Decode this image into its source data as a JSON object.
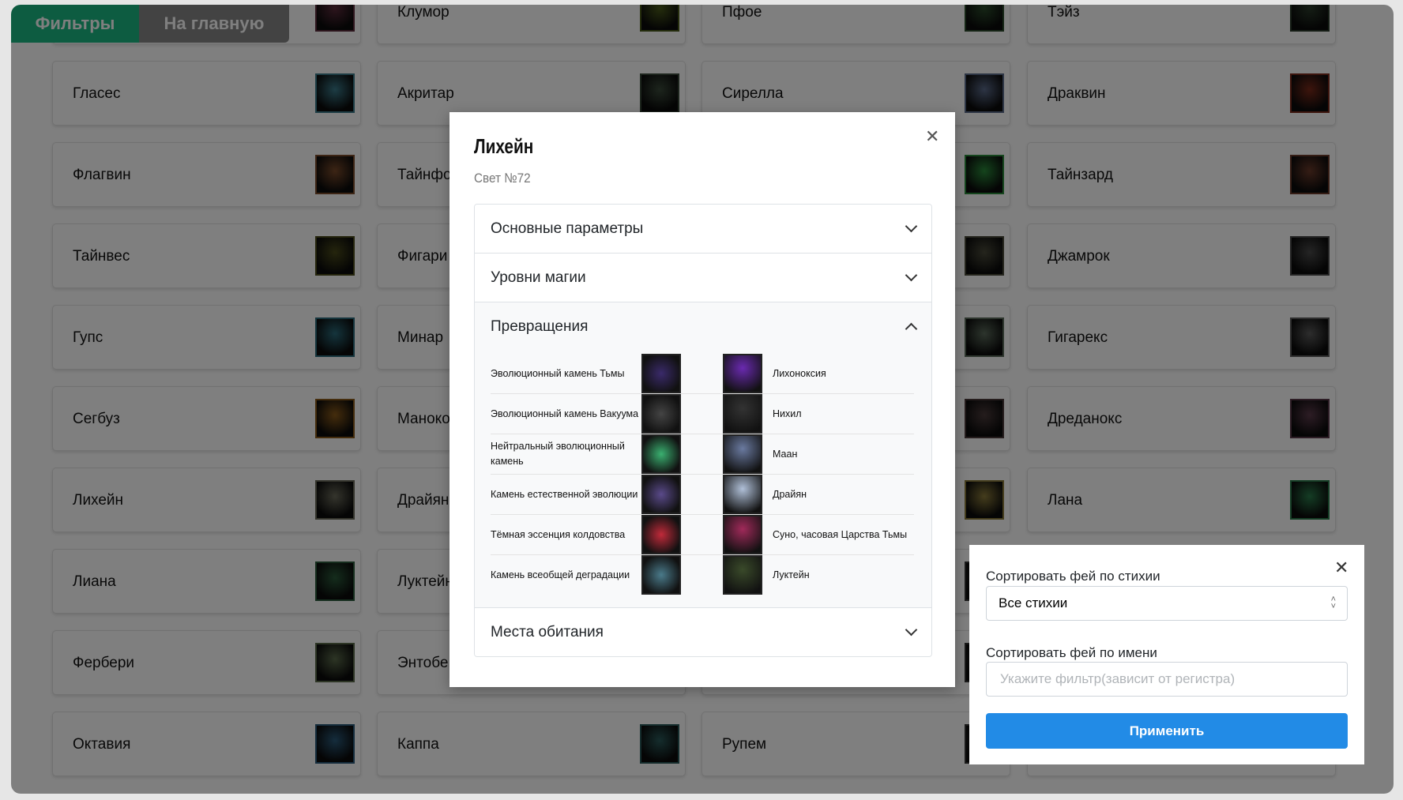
{
  "nav": {
    "filters_label": "Фильтры",
    "home_label": "На главную"
  },
  "cards": [
    {
      "name": "",
      "color": "#5a2a3a"
    },
    {
      "name": "Клумор",
      "color": "#4a5a1a"
    },
    {
      "name": "Пфое",
      "color": "#2a4a2a"
    },
    {
      "name": "Тэйз",
      "color": "#2a3a2a"
    },
    {
      "name": "Гласес",
      "color": "#3a7a8a"
    },
    {
      "name": "Акритар",
      "color": "#3a4a3a"
    },
    {
      "name": "Сирелла",
      "color": "#5a6a8a"
    },
    {
      "name": "Драквин",
      "color": "#7a2a1a"
    },
    {
      "name": "Флагвин",
      "color": "#7a4a2a"
    },
    {
      "name": "Тайнфо",
      "color": "#333"
    },
    {
      "name": "",
      "color": "#2a8a3a"
    },
    {
      "name": "Тайнзард",
      "color": "#6a3a2a"
    },
    {
      "name": "Тайнвес",
      "color": "#4a4a1a"
    },
    {
      "name": "Фигари",
      "color": "#333"
    },
    {
      "name": "",
      "color": "#4a4a3a"
    },
    {
      "name": "Джамрок",
      "color": "#4a4a4a"
    },
    {
      "name": "Гупс",
      "color": "#2a6a7a"
    },
    {
      "name": "Минар",
      "color": "#333"
    },
    {
      "name": "",
      "color": "#5a6a5a"
    },
    {
      "name": "Гигарекс",
      "color": "#5a5a5a"
    },
    {
      "name": "Сегбуз",
      "color": "#8a5a1a"
    },
    {
      "name": "Маноко",
      "color": "#333"
    },
    {
      "name": "",
      "color": "#4a3a3a"
    },
    {
      "name": "Дреданокс",
      "color": "#5a3a4a"
    },
    {
      "name": "Лихейн",
      "color": "#6a6a5a"
    },
    {
      "name": "Драйян",
      "color": "#333"
    },
    {
      "name": "",
      "color": "#8a7a3a"
    },
    {
      "name": "Лана",
      "color": "#2a7a4a"
    },
    {
      "name": "Лиана",
      "color": "#2a5a3a"
    },
    {
      "name": "Луктейн",
      "color": "#333"
    },
    {
      "name": "",
      "color": "#333"
    },
    {
      "name": "",
      "color": "#333"
    },
    {
      "name": "Фербери",
      "color": "#5a6a4a"
    },
    {
      "name": "Энтобе",
      "color": "#333"
    },
    {
      "name": "",
      "color": "#333"
    },
    {
      "name": "",
      "color": "#333"
    },
    {
      "name": "Октавия",
      "color": "#2a5a7a"
    },
    {
      "name": "Каппа",
      "color": "#2a5a5a"
    },
    {
      "name": "Рупем",
      "color": "#333"
    },
    {
      "name": "",
      "color": "#333"
    }
  ],
  "modal": {
    "title": "Лихейн",
    "subtitle": "Свет №72",
    "sections": {
      "main": "Основные параметры",
      "magic": "Уровни магии",
      "transform": "Превращения",
      "habitat": "Места обитания"
    },
    "transformations": [
      {
        "item": "Эволюционный камень Тьмы",
        "item_color": "#3a2a6a",
        "result": "Лихоноксия",
        "result_color": "#6a2ab0"
      },
      {
        "item": "Эволюционный камень Вакуума",
        "item_color": "#444",
        "result": "Нихил",
        "result_color": "#333"
      },
      {
        "item": "Нейтральный эволюционный камень",
        "item_color": "#3ab070",
        "result": "Маан",
        "result_color": "#6a7aa0"
      },
      {
        "item": "Камень естественной эволюции",
        "item_color": "#5a4a8a",
        "result": "Драйян",
        "result_color": "#b0c0d8"
      },
      {
        "item": "Тёмная эссенция колдовства",
        "item_color": "#c02a3a",
        "result": "Суно, часовая Царства Тьмы",
        "result_color": "#a02a5a"
      },
      {
        "item": "Камень всеобщей деградации",
        "item_color": "#4a7a8a",
        "result": "Луктейн",
        "result_color": "#3a4a2a"
      }
    ]
  },
  "filter": {
    "element_label": "Сортировать фей по стихии",
    "element_value": "Все стихии",
    "name_label": "Сортировать фей по имени",
    "name_placeholder": "Укажите фильтр(зависит от регистра)",
    "name_value": "",
    "apply_label": "Применить"
  }
}
